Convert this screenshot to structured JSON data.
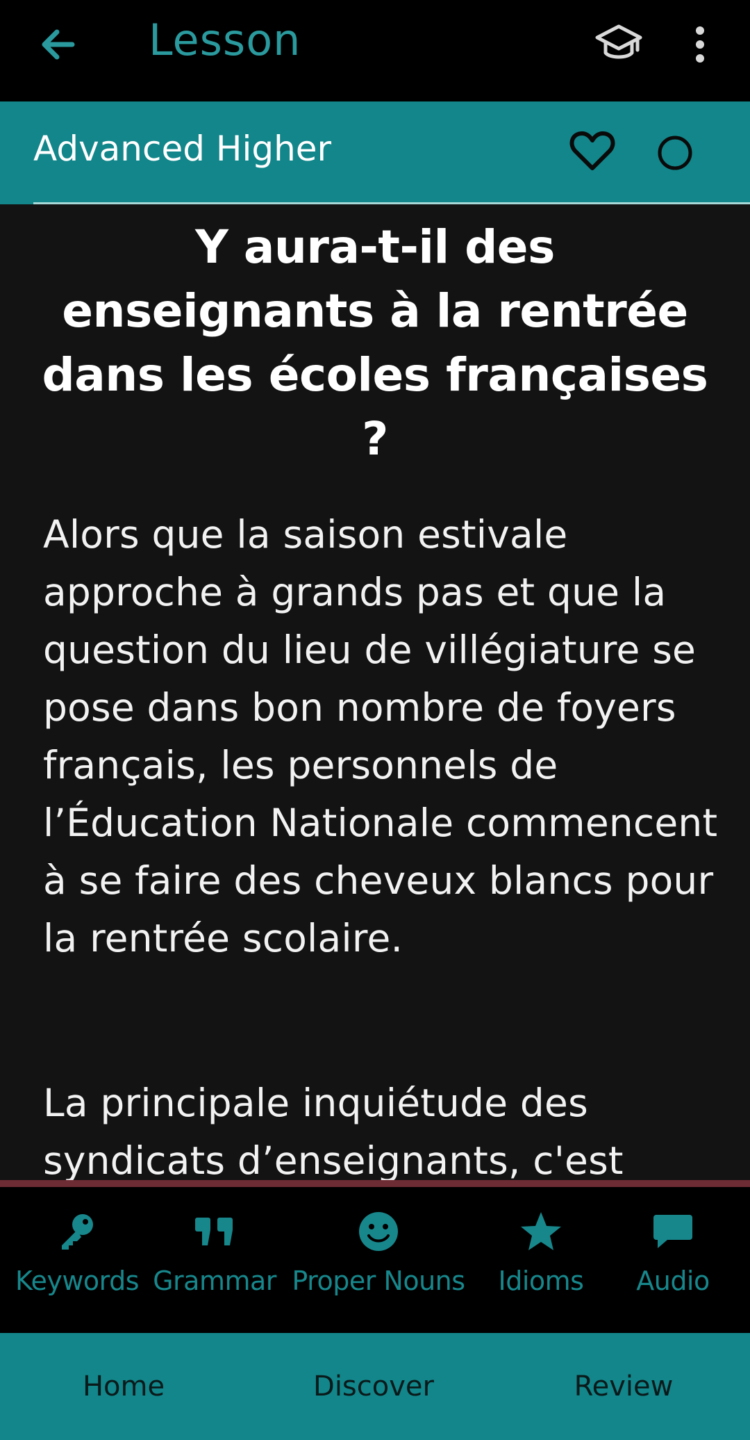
{
  "appbar": {
    "title": "Lesson",
    "icons": [
      "back-arrow-icon",
      "graduation-cap-icon",
      "more-vertical-icon"
    ]
  },
  "subbar": {
    "level": "Advanced Higher",
    "icons": [
      "heart-icon",
      "circle-icon"
    ]
  },
  "article": {
    "headline": "Y aura-t-il des enseignants à la rentrée dans les écoles françaises ?",
    "paragraphs": [
      "Alors que la saison estivale approche à grands pas et que la question du lieu de villégiature se pose dans bon nombre de foyers français, les personnels de l’Éducation Nationale commencent à se faire des cheveux blancs pour la rentrée scolaire.",
      "La principale inquiétude des syndicats d’enseignants, c'est"
    ]
  },
  "tools": [
    {
      "label": "Keywords",
      "icon": "key-icon"
    },
    {
      "label": "Grammar",
      "icon": "quote-icon"
    },
    {
      "label": "Proper Nouns",
      "icon": "smiley-icon"
    },
    {
      "label": "Idioms",
      "icon": "star-icon"
    },
    {
      "label": "Audio",
      "icon": "chat-bubble-icon"
    }
  ],
  "bottomnav": {
    "items": [
      "Home",
      "Discover",
      "Review"
    ]
  },
  "colors": {
    "teal": "#12868a",
    "teal_text": "#2a9a9e",
    "background": "#131313",
    "divider": "#6d2b34"
  }
}
